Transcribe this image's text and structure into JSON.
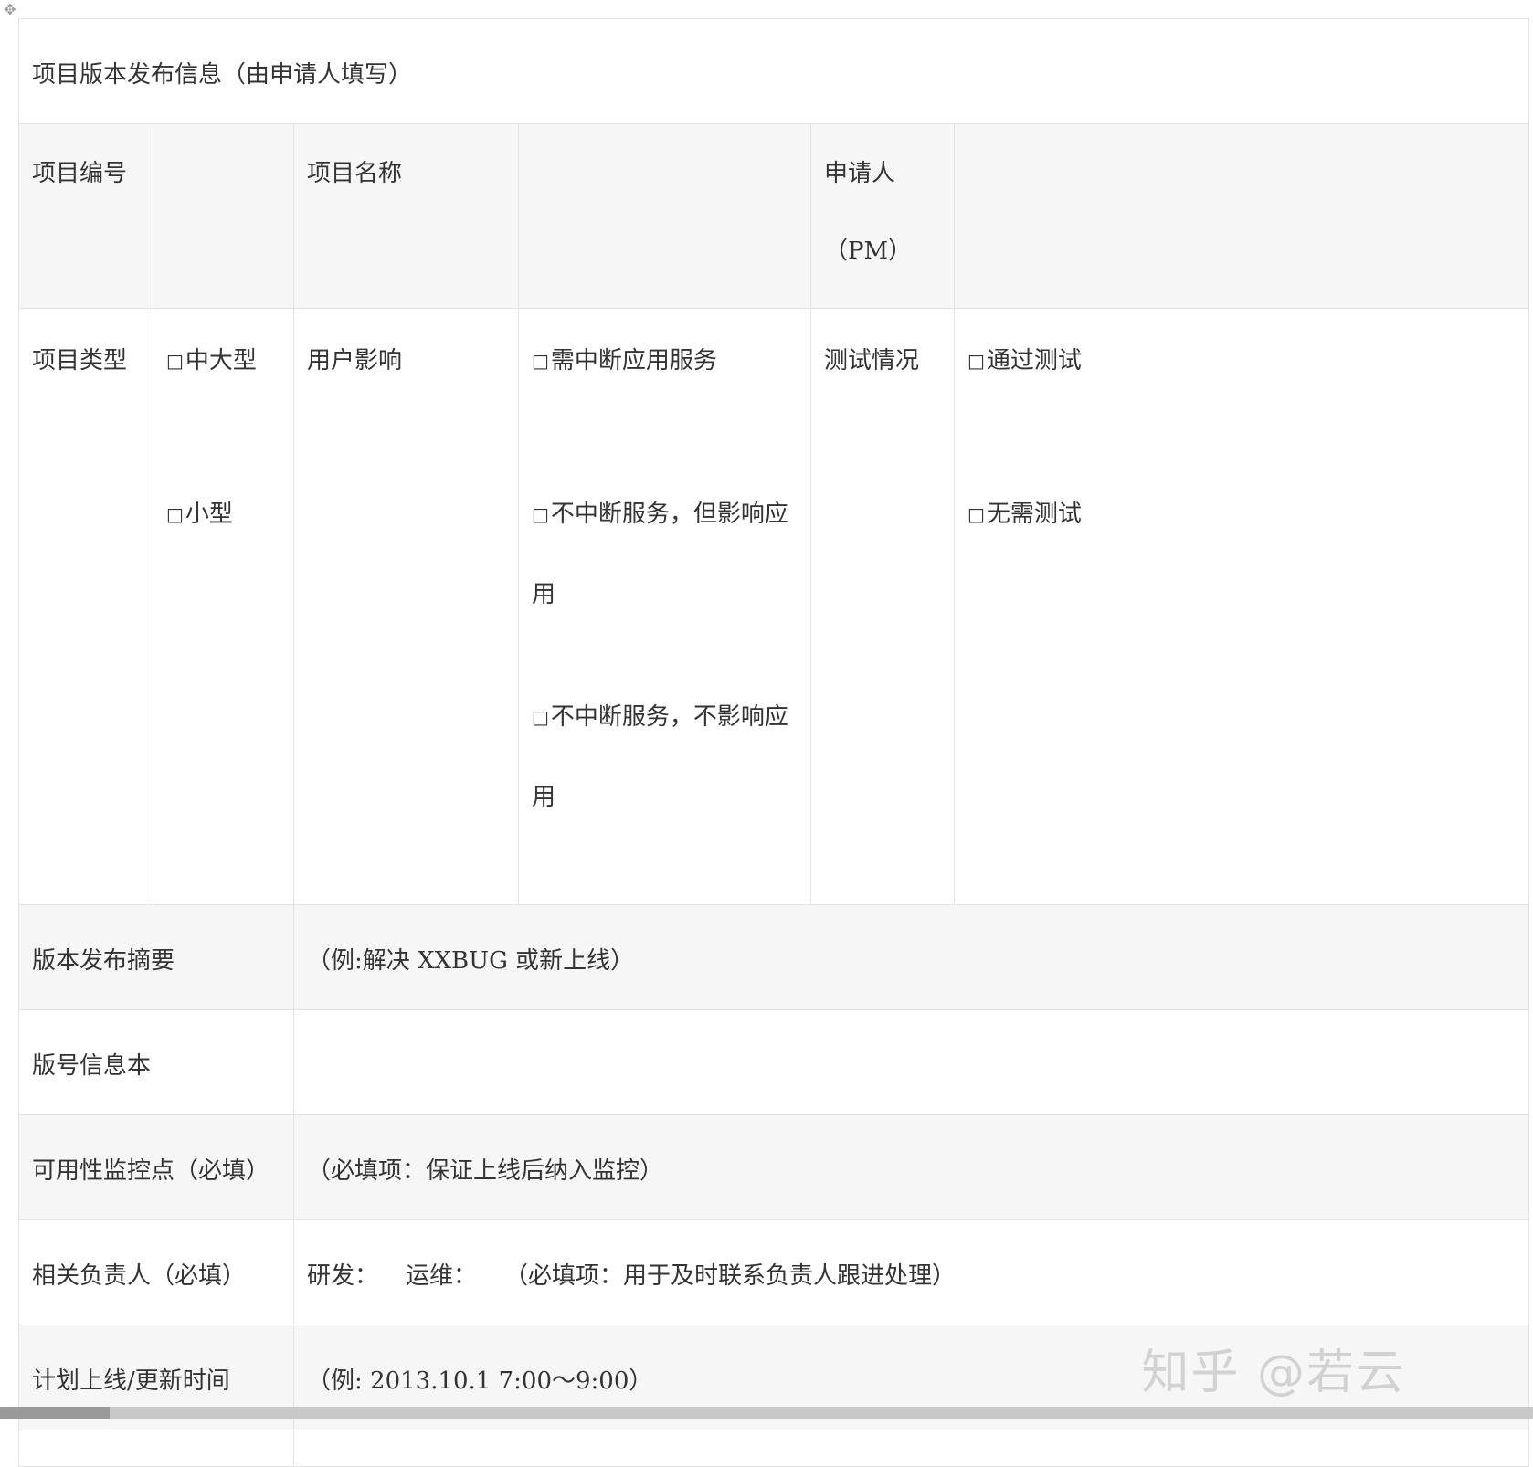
{
  "move_handle_icon": "move-icon",
  "title": "项目版本发布信息（由申请人填写）",
  "row_project": {
    "number_label": "项目编号",
    "number_value": "",
    "name_label": "项目名称",
    "name_value": "",
    "applicant_label": "申请人",
    "applicant_sub": "（PM）",
    "applicant_value": ""
  },
  "row_type": {
    "type_label": "项目类型",
    "type_options": [
      "中大型",
      "小型"
    ],
    "impact_label": "用户影响",
    "impact_options": [
      {
        "line1": "需中断应用服务",
        "line2": ""
      },
      {
        "line1": "不中断服务，但影响应",
        "line2": "用"
      },
      {
        "line1": "不中断服务，不影响应",
        "line2": "用"
      }
    ],
    "test_label": "测试情况",
    "test_options": [
      "通过测试",
      "无需测试"
    ]
  },
  "rows": {
    "summary_label": "版本发布摘要",
    "summary_value": "（例:解决 XXBUG 或新上线）",
    "version_label": "版号信息本",
    "version_value": "",
    "monitor_label": "可用性监控点（必填）",
    "monitor_value": "（必填项：保证上线后纳入监控）",
    "owner_label": "相关负责人（必填）",
    "owner_dev": "研发：",
    "owner_ops": "运维：",
    "owner_note": "（必填项：用于及时联系负责人跟进处理）",
    "schedule_label": "计划上线/更新时间",
    "schedule_value": "（例: 2013.10.1 7:00～9:00）"
  },
  "checkbox_glyph": "□",
  "watermark": "知乎 @若云"
}
